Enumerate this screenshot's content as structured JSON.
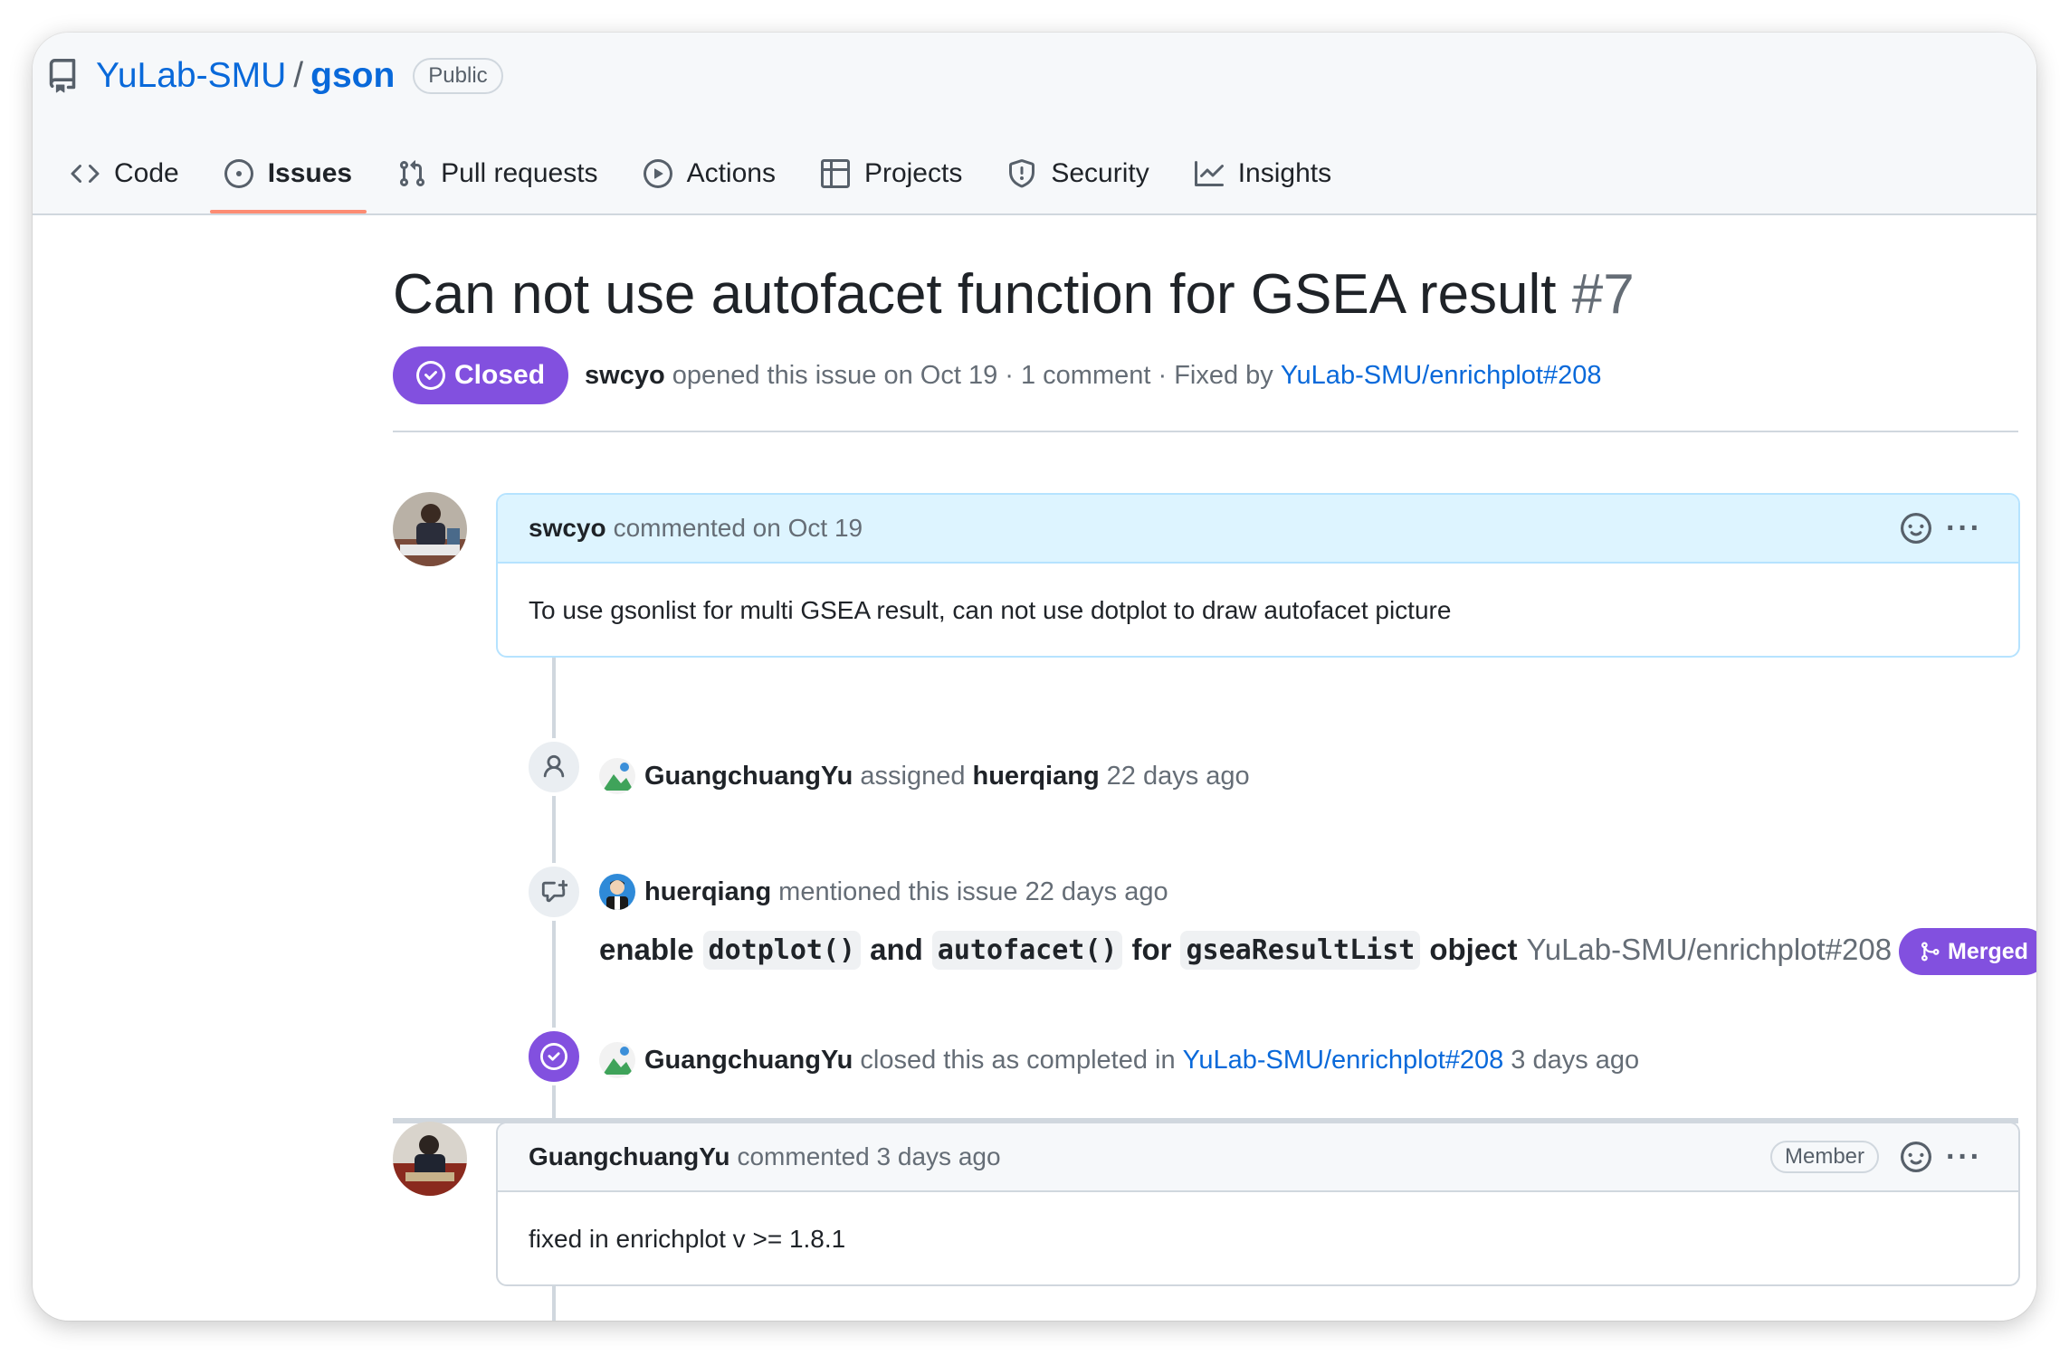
{
  "repo": {
    "owner": "YuLab-SMU",
    "slash": "/",
    "name": "gson",
    "visibility": "Public"
  },
  "tabs": [
    {
      "label": "Code",
      "icon": "code-icon"
    },
    {
      "label": "Issues",
      "icon": "issue-opened-icon",
      "active": true
    },
    {
      "label": "Pull requests",
      "icon": "git-pull-request-icon"
    },
    {
      "label": "Actions",
      "icon": "play-icon"
    },
    {
      "label": "Projects",
      "icon": "table-icon"
    },
    {
      "label": "Security",
      "icon": "shield-icon"
    },
    {
      "label": "Insights",
      "icon": "graph-icon"
    }
  ],
  "issue": {
    "title": "Can not use autofacet function for GSEA result",
    "number": "#7",
    "state": "Closed",
    "author": "swcyo",
    "opened_text": "opened this issue on Oct 19 · 1 comment · Fixed by",
    "fixed_by": "YuLab-SMU/enrichplot#208"
  },
  "comments": [
    {
      "author": "swcyo",
      "action": "commented on Oct 19",
      "body": "To use gsonlist for multi GSEA result, can not use dotplot to draw autofacet picture"
    },
    {
      "author": "GuangchuangYu",
      "action": "commented 3 days ago",
      "badge": "Member",
      "body": "fixed in enrichplot v >= 1.8.1"
    }
  ],
  "events": {
    "assigned": {
      "actor": "GuangchuangYu",
      "verb": "assigned",
      "target": "huerqiang",
      "time": "22 days ago"
    },
    "mentioned": {
      "actor": "huerqiang",
      "text": "mentioned this issue 22 days ago",
      "ref_title_1": "enable",
      "code_1": "dotplot()",
      "ref_title_2": "and",
      "code_2": "autofacet()",
      "ref_title_3": "for",
      "code_3": "gseaResultList",
      "ref_title_4": "object",
      "ref_repo": "YuLab-SMU/enrichplot#208",
      "ref_state": "Merged"
    },
    "closed": {
      "actor": "GuangchuangYu",
      "text": "closed this as completed in",
      "link": "YuLab-SMU/enrichplot#208",
      "time": "3 days ago"
    }
  },
  "colors": {
    "accent_blue": "#0969da",
    "closed_purple": "#8250df",
    "tab_underline": "#fd8c73",
    "author_header_bg": "#ddf4ff"
  }
}
